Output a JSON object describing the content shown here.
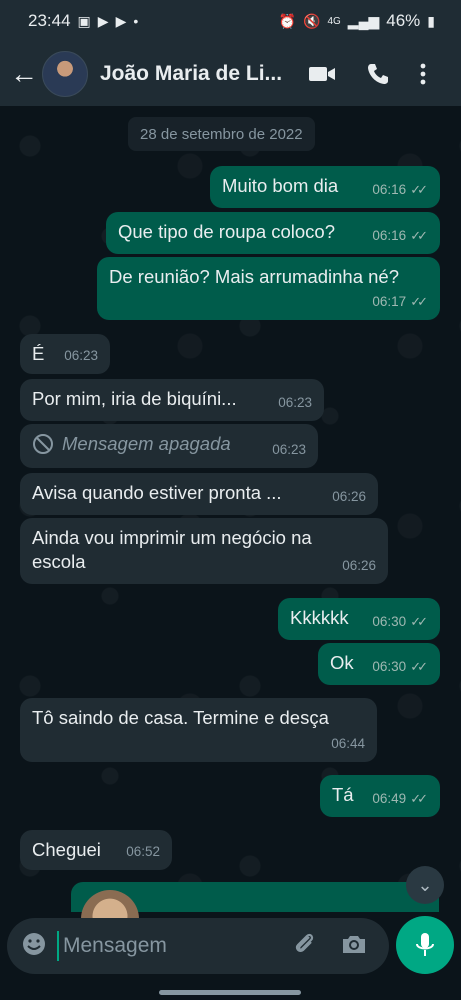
{
  "statusbar": {
    "time": "23:44",
    "left_icons": [
      "image-icon",
      "youtube-icon",
      "youtube-icon"
    ],
    "dot": "•",
    "right_icons": [
      "alarm-icon",
      "mute-icon",
      "lte-signal-icon",
      "signal-icon"
    ],
    "network": "4G",
    "battery": "46%"
  },
  "header": {
    "contact_name": "João Maria de Li...",
    "actions": [
      "video-call-icon",
      "call-icon",
      "menu-icon"
    ]
  },
  "chat": {
    "date": "28 de setembro de 2022",
    "messages": [
      {
        "dir": "out",
        "text": "Muito bom dia",
        "time": "06:16"
      },
      {
        "dir": "out",
        "text": "Que tipo de roupa coloco?",
        "time": "06:16"
      },
      {
        "dir": "out",
        "text": "De reunião? Mais arrumadinha né?",
        "time": "06:17"
      },
      {
        "dir": "in",
        "text": "É",
        "time": "06:23"
      },
      {
        "dir": "in",
        "text": "Por mim, iria de biquíni...",
        "time": "06:23"
      },
      {
        "dir": "in",
        "text": "Mensagem apagada",
        "time": "06:23",
        "deleted": true
      },
      {
        "dir": "in",
        "text": "Avisa quando estiver pronta ...",
        "time": "06:26"
      },
      {
        "dir": "in",
        "text": "Ainda vou imprimir um negócio na escola",
        "time": "06:26"
      },
      {
        "dir": "out",
        "text": "Kkkkkk",
        "time": "06:30"
      },
      {
        "dir": "out",
        "text": "Ok",
        "time": "06:30"
      },
      {
        "dir": "in",
        "text": "Tô saindo de casa.  Termine e desça",
        "time": "06:44"
      },
      {
        "dir": "out",
        "text": "Tá",
        "time": "06:49"
      },
      {
        "dir": "in",
        "text": "Cheguei",
        "time": "06:52"
      }
    ]
  },
  "composer": {
    "placeholder": "Mensagem",
    "icons": [
      "emoji-icon",
      "attach-icon",
      "camera-icon",
      "mic-icon"
    ]
  },
  "colors": {
    "background": "#0b141a",
    "outgoing_bubble": "#005c4b",
    "incoming_bubble": "#202c33",
    "accent": "#00a884"
  }
}
